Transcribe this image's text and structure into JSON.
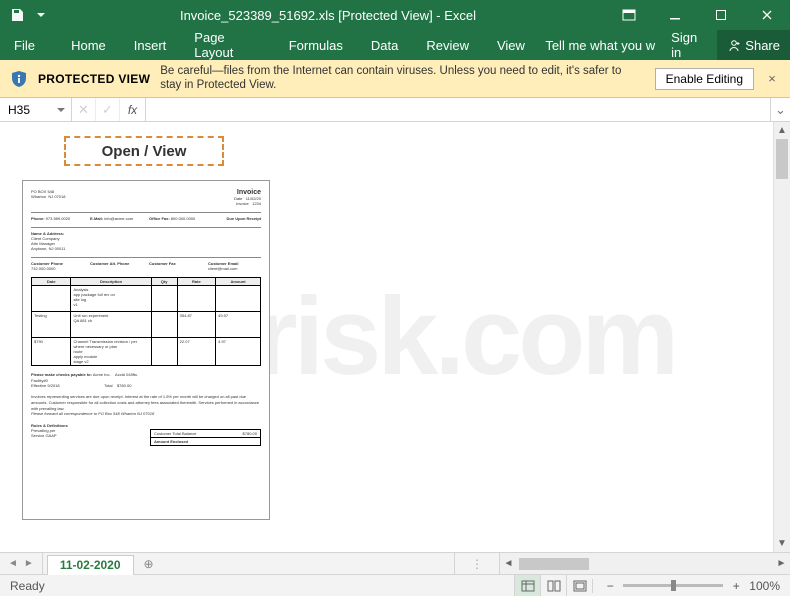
{
  "titlebar": {
    "title": "Invoice_523389_51692.xls  [Protected View] - Excel"
  },
  "ribbon": {
    "file": "File",
    "tabs": [
      "Home",
      "Insert",
      "Page Layout",
      "Formulas",
      "Data",
      "Review",
      "View"
    ],
    "tellme": "Tell me what you w",
    "signin": "Sign in",
    "share": "Share"
  },
  "protected_view": {
    "label": "PROTECTED VIEW",
    "message": "Be careful—files from the Internet can contain viruses. Unless you need to edit, it's safer to stay in Protected View.",
    "button": "Enable Editing"
  },
  "formula_bar": {
    "namebox": "H35",
    "fx": "fx"
  },
  "sheet": {
    "open_view": "Open / View",
    "invoice_title": "Invoice",
    "due_label": "Due Upon Receipt",
    "totals": {
      "customer_total_balance_label": "Customer Total Balance",
      "amount_enclosed_label": "Amount Enclosed"
    }
  },
  "tabs": {
    "sheet_name": "11-02-2020"
  },
  "status": {
    "ready": "Ready",
    "zoom": "100%"
  },
  "watermark": "risk.com"
}
